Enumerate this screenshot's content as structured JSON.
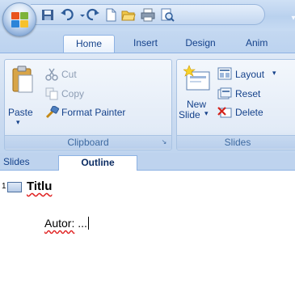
{
  "tabs": [
    {
      "label": "Home",
      "active": true
    },
    {
      "label": "Insert",
      "active": false
    },
    {
      "label": "Design",
      "active": false
    },
    {
      "label": "Anim",
      "active": false
    }
  ],
  "quick_access": {
    "icons": [
      "save-icon",
      "undo-icon",
      "undo-dropdown-icon",
      "redo-icon",
      "new-icon",
      "open-icon",
      "print-icon",
      "print-preview-icon",
      "customize-dropdown-icon"
    ]
  },
  "ribbon": {
    "clipboard": {
      "label": "Clipboard",
      "paste_label": "Paste",
      "cut_label": "Cut",
      "copy_label": "Copy",
      "format_painter_label": "Format Painter"
    },
    "slides": {
      "label": "Slides",
      "new_label": "New",
      "slide_label": "Slide",
      "layout_label": "Layout",
      "reset_label": "Reset",
      "delete_label": "Delete"
    }
  },
  "pane": {
    "tabs": [
      "Slides",
      "Outline"
    ],
    "active_tab": "Outline"
  },
  "outline": {
    "slide_number": "1",
    "title": "Titlu",
    "body_label": "Autor:",
    "body_value": "..."
  },
  "colors": {
    "accent": "#15428b",
    "ribbon_bg": "#dfe9f6",
    "spellcheck": "#e02020"
  }
}
